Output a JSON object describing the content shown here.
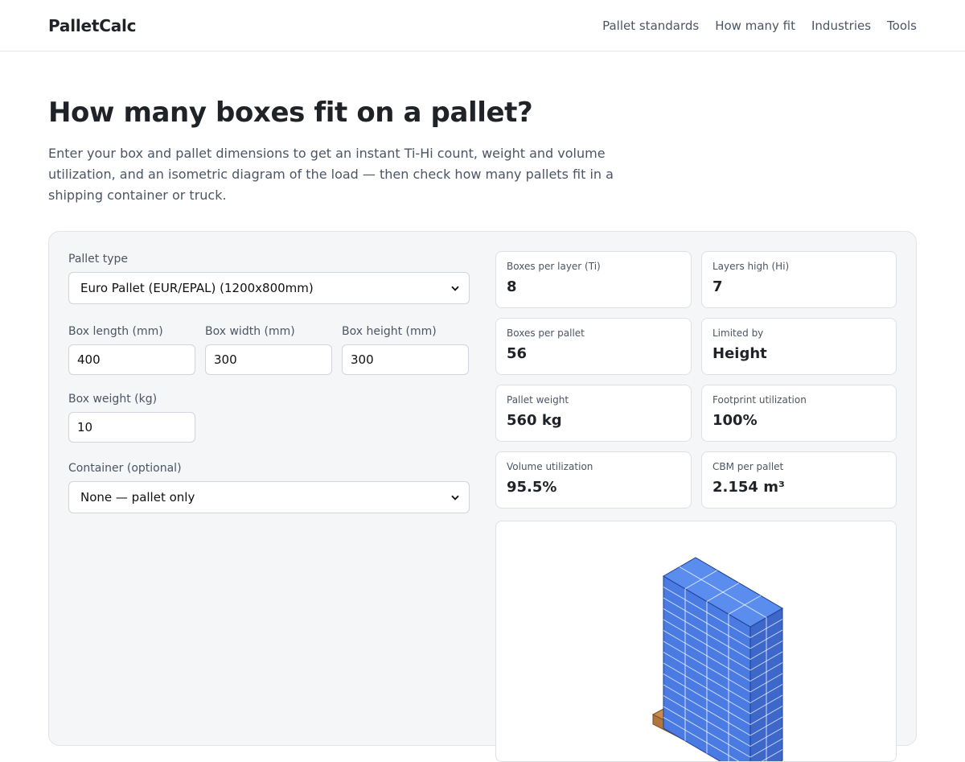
{
  "header": {
    "logo": "PalletCalc",
    "nav": [
      "Pallet standards",
      "How many fit",
      "Industries",
      "Tools"
    ]
  },
  "hero": {
    "title": "How many boxes fit on a pallet?",
    "description": "Enter your box and pallet dimensions to get an instant Ti-Hi count, weight and volume utilization, and an isometric diagram of the load — then check how many pallets fit in a shipping container or truck."
  },
  "form": {
    "pallet_type": {
      "label": "Pallet type",
      "value": "Euro Pallet (EUR/EPAL) (1200x800mm)"
    },
    "box_length": {
      "label": "Box length (mm)",
      "value": "400"
    },
    "box_width": {
      "label": "Box width (mm)",
      "value": "300"
    },
    "box_height": {
      "label": "Box height (mm)",
      "value": "300"
    },
    "box_weight": {
      "label": "Box weight (kg)",
      "value": "10"
    },
    "container": {
      "label": "Container (optional)",
      "value": "None — pallet only"
    }
  },
  "results": [
    {
      "label": "Boxes per layer (Ti)",
      "value": "8"
    },
    {
      "label": "Layers high (Hi)",
      "value": "7"
    },
    {
      "label": "Boxes per pallet",
      "value": "56"
    },
    {
      "label": "Limited by",
      "value": "Height"
    },
    {
      "label": "Pallet weight",
      "value": "560 kg"
    },
    {
      "label": "Footprint utilization",
      "value": "100%"
    },
    {
      "label": "Volume utilization",
      "value": "95.5%"
    },
    {
      "label": "CBM per pallet",
      "value": "2.154 m³"
    }
  ],
  "colors": {
    "box_top": "#5b8def",
    "box_front": "#4a7be3",
    "box_side": "#3d67c9",
    "pallet_wood": "#c98b4c"
  }
}
